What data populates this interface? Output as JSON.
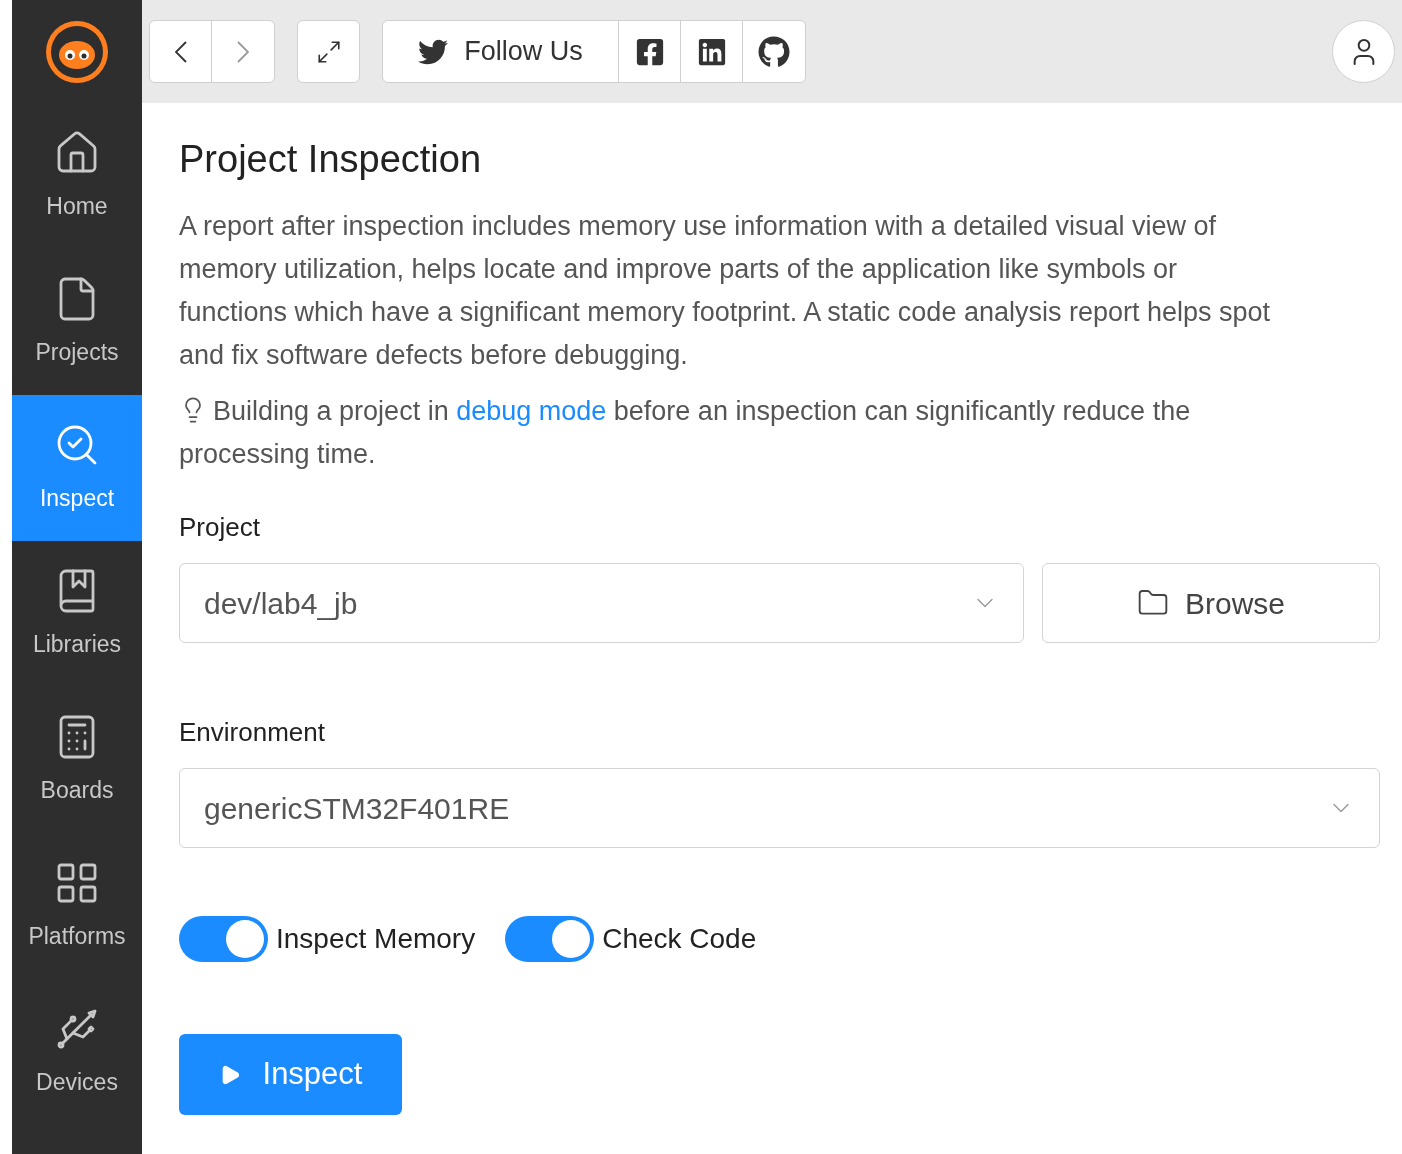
{
  "sidebar": {
    "items": [
      {
        "kind": "home",
        "label": "Home",
        "selected": false
      },
      {
        "kind": "projects",
        "label": "Projects",
        "selected": false
      },
      {
        "kind": "inspect",
        "label": "Inspect",
        "selected": true
      },
      {
        "kind": "libraries",
        "label": "Libraries",
        "selected": false
      },
      {
        "kind": "boards",
        "label": "Boards",
        "selected": false
      },
      {
        "kind": "platforms",
        "label": "Platforms",
        "selected": false
      },
      {
        "kind": "devices",
        "label": "Devices",
        "selected": false
      }
    ]
  },
  "toolbar": {
    "follow_label": "Follow Us"
  },
  "page": {
    "title": "Project Inspection",
    "description": "A report after inspection includes memory use information with a detailed visual view of memory utilization, helps locate and improve parts of the application like symbols or functions which have a significant memory footprint. A static code analysis report helps spot and fix software defects before debugging.",
    "tip_before": "Building a project in",
    "tip_link": "debug mode",
    "tip_after": "before an inspection can significantly reduce the processing time.",
    "project": {
      "label": "Project",
      "value": "dev/lab4_jb",
      "browse_label": "Browse"
    },
    "environment": {
      "label": "Environment",
      "value": "genericSTM32F401RE"
    },
    "switches": [
      {
        "label": "Inspect Memory",
        "on": true
      },
      {
        "label": "Check Code",
        "on": true
      }
    ],
    "action_label": "Inspect"
  }
}
